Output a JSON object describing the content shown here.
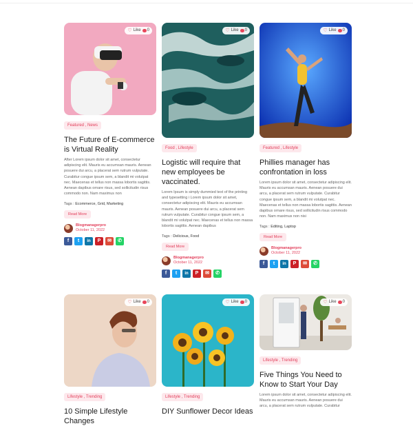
{
  "cards": [
    {
      "like_label": "Like",
      "like_count": "0",
      "categories": "Featured , News",
      "title": "The Future of E-commerce is Virtual Reality",
      "excerpt": "After Lorem ipsum dolor sit amet, consectetur adipiscing elit. Mauris eu accumsan mauris. Aenean posuere dui arcu, a placerat sem rutrum vulputate. Curabitur congue ipsum sem, a blandit mi volutpat nec. Maecenas et tellus non massa lobortis sagittis. Aenean dapibus ornare risus, sed sollicitudin risus commodo non. Nam maximus non",
      "tags_label": "Tags :",
      "tags": "Ecommerce, Grid, Marketing",
      "read_more": "Read More",
      "author": "Blogmanagerpro",
      "date": "October 11, 2022"
    },
    {
      "like_label": "Like",
      "like_count": "0",
      "categories": "Food , Lifestyle",
      "title": "Logistic will require that new employees be vaccinated.",
      "excerpt": "Lorem Ipsum is simply dummied text of the printing and typesetting i Lorem ipsum dolor sit amet, consectetur adipiscing elit. Mauris eu accumsan mauris. Aenean posuere dui arcu, a placerat sem rutrum vulputate. Curabitur congue ipsum sem, a blandit mi volutpat nec. Maecenas et tellus non massa lobortis sagittis. Aenean dapibus",
      "tags_label": "Tags :",
      "tags": "Delicious, Food",
      "read_more": "Read More",
      "author": "Blogmanagerpro",
      "date": "October 11, 2022"
    },
    {
      "like_label": "Like",
      "like_count": "0",
      "categories": "Featured , Lifestyle",
      "title": "Phillies manager has confrontation in loss",
      "excerpt": "Lorem ipsum dolor sit amet, consectetur adipiscing elit. Mauris eu accumsan mauris. Aenean posuere dui arcu, a placerat sem rutrum vulputate. Curabitur congue ipsum sem, a blandit mi volutpat nec. Maecenas et tellus non massa lobortis sagittis. Aenean dapibus ornare risus, sed sollicitudin risus commodo non. Nam maximus non nisi",
      "tags_label": "Tags :",
      "tags": "Editing, Laptop",
      "read_more": "Read More",
      "author": "Blogmanagerpro",
      "date": "October 11, 2022"
    },
    {
      "like_label": "Like",
      "like_count": "0",
      "categories": "Lifestyle , Trending",
      "title": "10 Simple Lifestyle Changes"
    },
    {
      "like_label": "Like",
      "like_count": "0",
      "categories": "Lifestyle , Trending",
      "title": "DIY Sunflower Decor Ideas"
    },
    {
      "like_label": "Like",
      "like_count": "0",
      "categories": "Lifestyle , Trending",
      "title": "Five Things You Need to Know to Start Your Day",
      "excerpt": "Lorem ipsum dolor sit amet, consectetur adipiscing elit. Mauris eu accumsan mauris. Aenean posuere dui arcu, a placerat sem rutrum vulputate. Curabitur congue ipsum sem, a blandit mi volutpat"
    }
  ],
  "share_icons": [
    {
      "name": "facebook-icon",
      "glyph": "f",
      "color": "#3b5998"
    },
    {
      "name": "twitter-icon",
      "glyph": "t",
      "color": "#1da1f2"
    },
    {
      "name": "linkedin-icon",
      "glyph": "in",
      "color": "#0e76a8"
    },
    {
      "name": "pinterest-icon",
      "glyph": "P",
      "color": "#cb2027"
    },
    {
      "name": "email-icon",
      "glyph": "✉",
      "color": "#dd4b39"
    },
    {
      "name": "whatsapp-icon",
      "glyph": "✆",
      "color": "#25d366"
    }
  ],
  "colors": {
    "accent": "#e23e5a",
    "tag_bg": "#fde8ec"
  }
}
